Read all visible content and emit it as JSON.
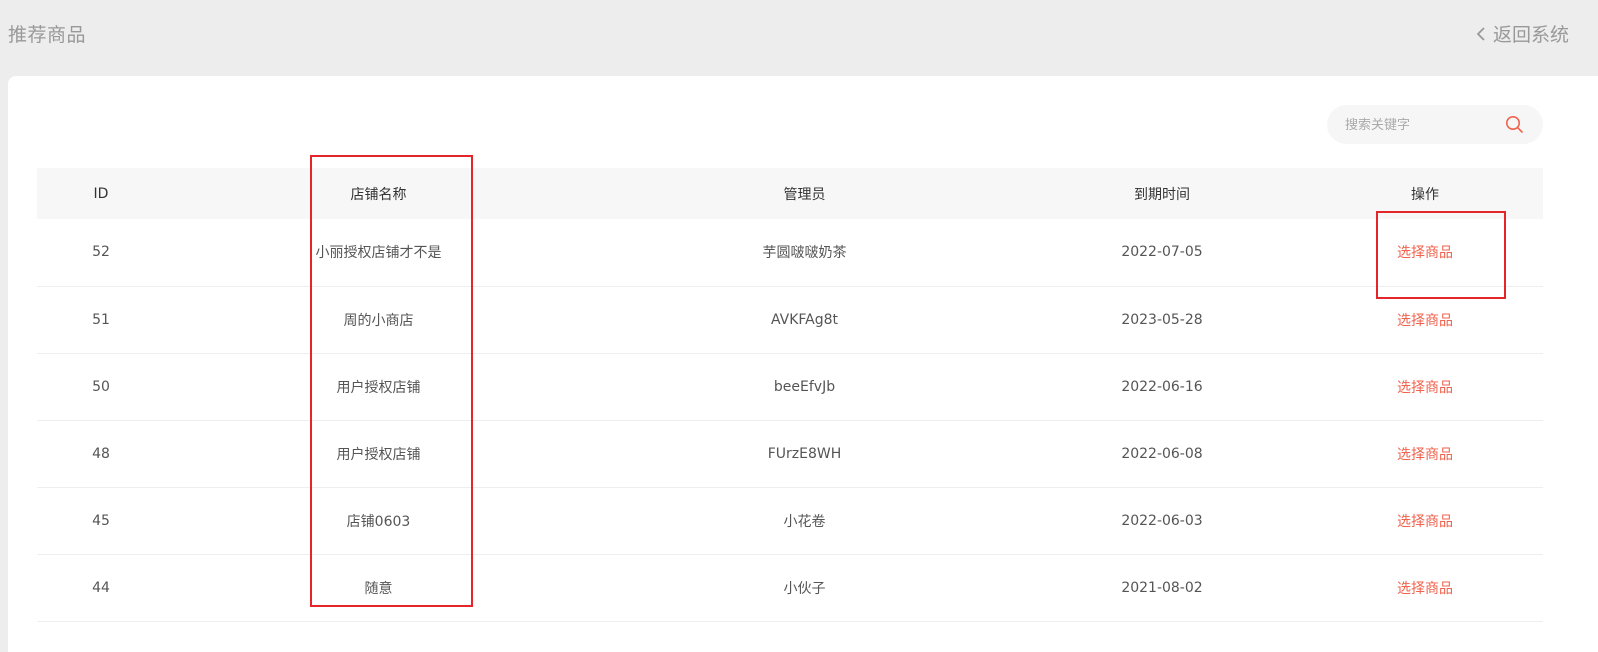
{
  "header": {
    "title": "推荐商品",
    "back_label": "返回系统"
  },
  "search": {
    "placeholder": "搜索关键字"
  },
  "table": {
    "columns": [
      "ID",
      "店铺名称",
      "管理员",
      "到期时间",
      "操作"
    ],
    "rows": [
      {
        "id": "52",
        "shop": "小丽授权店铺才不是",
        "admin": "芋圆啵啵奶茶",
        "expire": "2022-07-05",
        "action": "选择商品"
      },
      {
        "id": "51",
        "shop": "周的小商店",
        "admin": "AVKFAg8t",
        "expire": "2023-05-28",
        "action": "选择商品"
      },
      {
        "id": "50",
        "shop": "用户授权店铺",
        "admin": "beeEfvJb",
        "expire": "2022-06-16",
        "action": "选择商品"
      },
      {
        "id": "48",
        "shop": "用户授权店铺",
        "admin": "FUrzE8WH",
        "expire": "2022-06-08",
        "action": "选择商品"
      },
      {
        "id": "45",
        "shop": "店铺0603",
        "admin": "小花卷",
        "expire": "2022-06-03",
        "action": "选择商品"
      },
      {
        "id": "44",
        "shop": "随意",
        "admin": "小伙子",
        "expire": "2021-08-02",
        "action": "选择商品"
      }
    ]
  },
  "colors": {
    "accent": "#f0624d",
    "highlight_box": "#e4262a"
  },
  "icons": {
    "back": "chevron-left-icon",
    "search": "search-icon"
  }
}
